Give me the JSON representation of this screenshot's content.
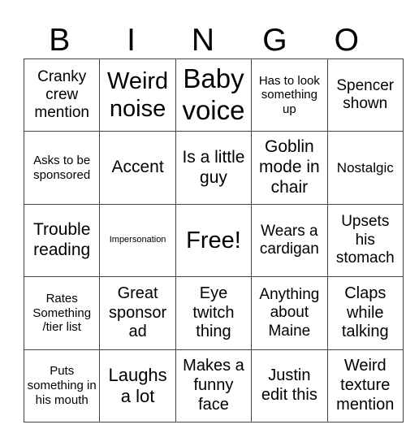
{
  "header": {
    "letters": [
      "B",
      "I",
      "N",
      "G",
      "O"
    ]
  },
  "board": {
    "rows": [
      [
        "Cranky crew mention",
        "Weird noise",
        "Baby voice",
        "Has to look something up",
        "Spencer shown"
      ],
      [
        "Asks to be sponsored",
        "Accent",
        "Is a little guy",
        "Goblin mode in chair",
        "Nostalgic"
      ],
      [
        "Trouble reading",
        "Impersonation",
        "Free!",
        "Wears a cardigan",
        "Upsets his stomach"
      ],
      [
        "Rates Something /tier list",
        "Great sponsor ad",
        "Eye twitch thing",
        "Anything about Maine",
        "Claps while talking"
      ],
      [
        "Puts something in his mouth",
        "Laughs a lot",
        "Makes a funny face",
        "Justin edit this",
        "Weird texture mention"
      ]
    ]
  }
}
